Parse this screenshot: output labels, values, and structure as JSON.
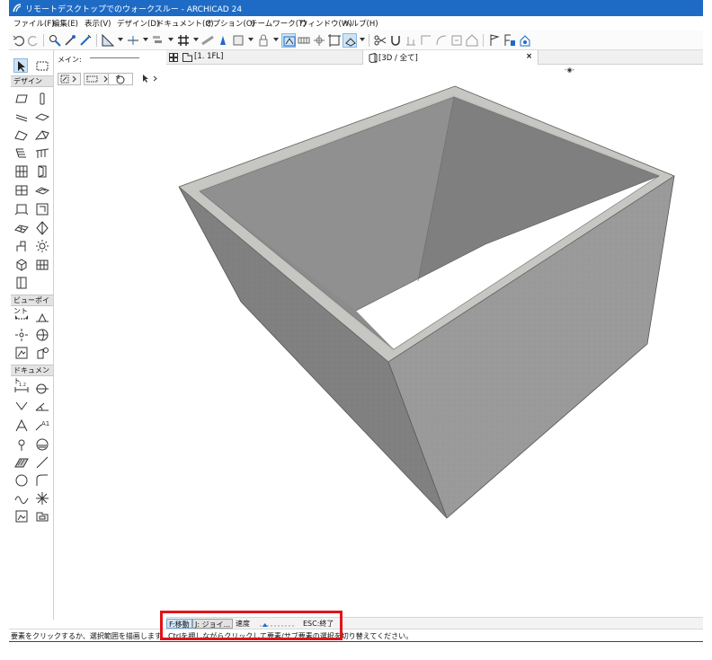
{
  "window": {
    "title": "リモートデスクトップでのウォークスルー - ARCHICAD 24"
  },
  "menu": [
    "ファイル(F)",
    "編集(E)",
    "表示(V)",
    "デザイン(D)",
    "ドキュメント(C)",
    "オプション(O)",
    "チームワーク(T)",
    "ウィンドウ(W)",
    "ヘルプ(H)"
  ],
  "toolbox": {
    "sections": {
      "design": "デザイン",
      "viewpoint": "ビューポイント",
      "document": "ドキュメント"
    },
    "icons": {
      "arrow": "arrow-pointer-icon",
      "marquee": "marquee-icon",
      "wall": "wall-icon",
      "column": "column-icon",
      "beam": "beam-icon",
      "slab": "slab-icon",
      "roof": "roof-icon",
      "shell": "shell-icon",
      "stair": "stair-icon",
      "railing": "railing-icon",
      "curtain_wall": "curtain-wall-icon",
      "door": "door-icon",
      "window": "window-icon",
      "skylight": "skylight-icon",
      "opening": "opening-icon",
      "corner_window": "corner-window-icon",
      "mesh": "mesh-icon",
      "morph": "morph-icon",
      "object": "object-icon",
      "lamp": "lamp-icon",
      "zone": "zone-icon",
      "wall_end": "wall-end-icon",
      "section": "section-icon",
      "elevation": "elevation-icon",
      "interior_elevation": "interior-elevation-icon",
      "worksheet": "worksheet-icon",
      "detail": "detail-icon",
      "change": "change-icon",
      "dimension": "dimension-icon",
      "radial_dimension": "radial-dimension-icon",
      "level_dimension": "level-dimension-icon",
      "angle_dimension": "angle-dimension-icon",
      "text": "text-icon",
      "label": "label-icon",
      "fill": "fill-icon",
      "figure": "figure-icon",
      "hotspot": "hotspot-icon",
      "line": "line-icon",
      "circle": "circle-icon",
      "polyline": "polyline-icon",
      "spline": "spline-icon",
      "drawing": "drawing-icon",
      "camera": "camera-icon"
    }
  },
  "infobox": {
    "label": "メイン:"
  },
  "tabs": {
    "floor_plan": "[1. 1FL]",
    "view3d": "[3D / 全て]",
    "close": "×"
  },
  "viewport": {
    "nav_widget": "-◉-"
  },
  "walkthrough": {
    "move": "F:移動",
    "joystick": "J: ジョイ...",
    "speed_label": "速度",
    "speed_level": 0.15,
    "exit": "ESC:終了"
  },
  "statusbar": {
    "message": "要素をクリックするか、選択範囲を描画します。Ctrlを押しながらクリックして要素/サブ要素の選択を切り替えてください。"
  },
  "colors": {
    "titlebar": "#1e6bc5",
    "highlight_frame": "#e1141b"
  }
}
